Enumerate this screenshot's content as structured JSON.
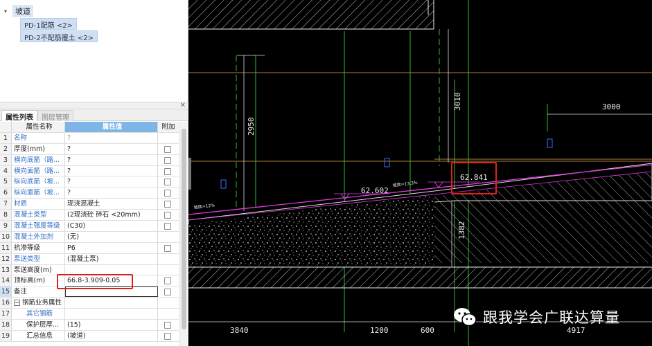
{
  "tree": {
    "root_label": "坡道",
    "children": [
      "PD-1配筋 <2>",
      "PD-2不配筋覆土 <2>"
    ]
  },
  "tabs": {
    "active": "属性列表",
    "inactive": "图层管理"
  },
  "table": {
    "headers": {
      "name": "属性名称",
      "value": "属性值",
      "add": "附加"
    },
    "rows": [
      {
        "num": "1",
        "name": "名称",
        "value": "?",
        "check": false
      },
      {
        "num": "2",
        "name": "厚度(mm)",
        "value": "?",
        "check": true
      },
      {
        "num": "3",
        "name": "横向底筋（路...",
        "value": "?",
        "check": true
      },
      {
        "num": "4",
        "name": "横向面筋（路...",
        "value": "?",
        "check": true
      },
      {
        "num": "5",
        "name": "纵向底筋（坡...",
        "value": "?",
        "check": true
      },
      {
        "num": "6",
        "name": "纵向面筋（坡...",
        "value": "?",
        "check": true
      },
      {
        "num": "7",
        "name": "材质",
        "value": "现浇混凝土",
        "check": true
      },
      {
        "num": "8",
        "name": "混凝土类型",
        "value": "(2现浇砼 碎石 <20mm)",
        "check": true
      },
      {
        "num": "9",
        "name": "混凝土强度等级",
        "value": "(C30)",
        "check": true
      },
      {
        "num": "10",
        "name": "混凝土外加剂",
        "value": "(无)",
        "check": false
      },
      {
        "num": "11",
        "name": "抗渗等级",
        "value": "P6",
        "check": true
      },
      {
        "num": "12",
        "name": "泵送类型",
        "value": "(混凝土泵)",
        "check": false
      },
      {
        "num": "13",
        "name": "泵送高度(m)",
        "value": "",
        "check": false
      },
      {
        "num": "14",
        "name": "顶标高(m)",
        "value": "66.8-3.909-0.05",
        "check": true
      },
      {
        "num": "15",
        "name": "备注",
        "value": "",
        "check": true
      },
      {
        "num": "16",
        "name": "钢筋业务属性",
        "value": "",
        "check": false
      },
      {
        "num": "17",
        "name": "其它钢筋",
        "value": "",
        "check": false
      },
      {
        "num": "18",
        "name": "保护层厚...",
        "value": "(15)",
        "check": true
      },
      {
        "num": "19",
        "name": "汇总信息",
        "value": "(坡道)",
        "check": true
      }
    ]
  },
  "cad": {
    "dims": {
      "d3010": "3010",
      "d2950": "2950",
      "d3000": "3000",
      "d1382": "1382",
      "d3840": "3840",
      "d1200": "1200",
      "d600": "600",
      "d4917": "4917"
    },
    "elevations": {
      "e1": "62.602",
      "e2": "62.841"
    },
    "slopes": {
      "s1": "坡度=13.3%",
      "s2": "坡度=12%"
    }
  },
  "watermark": {
    "text": "跟我学会广联达算量",
    "icon": "wechat-icon"
  },
  "colors": {
    "canvas": "#000000",
    "accent_red": "#e0201e",
    "header_blue": "#7fb4e6"
  }
}
